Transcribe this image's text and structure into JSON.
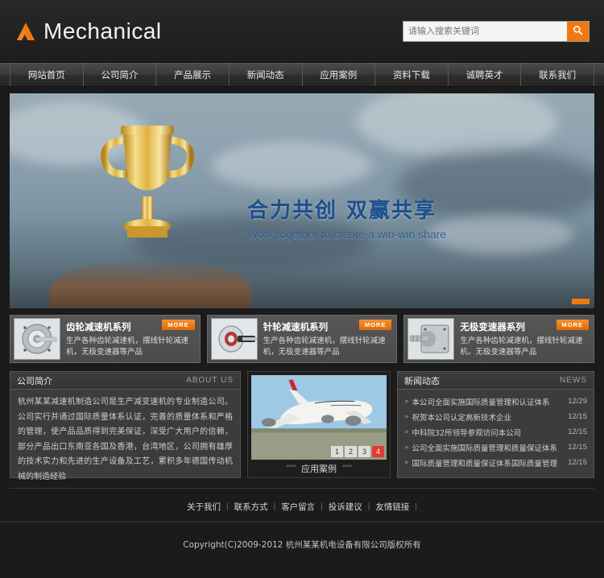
{
  "header": {
    "logo_text": "Mechanical",
    "logo_icon": "mountain-triangle-icon",
    "search": {
      "placeholder": "请输入搜索关键词",
      "value": "",
      "button_icon": "search-icon"
    },
    "accent_color": "#ef7911"
  },
  "nav": {
    "items": [
      {
        "label": "网站首页"
      },
      {
        "label": "公司简介"
      },
      {
        "label": "产品展示"
      },
      {
        "label": "新闻动态"
      },
      {
        "label": "应用案例"
      },
      {
        "label": "资料下载"
      },
      {
        "label": "诚聘英才"
      },
      {
        "label": "联系我们"
      }
    ]
  },
  "banner": {
    "title": "合力共创  双赢共享",
    "subtitle": "Work together to create a win-win share",
    "title_color": "#1c4f8c",
    "slides": [
      {
        "active": false
      },
      {
        "active": true
      }
    ]
  },
  "product_cards": [
    {
      "title": "齿轮减速机系列",
      "desc": "生产各种齿轮减速机，摆线针轮减速机，无极变速器等产品",
      "more_label": "MORE",
      "thumb_icon": "gear-reducer-icon"
    },
    {
      "title": "针轮减速机系列",
      "desc": "生产各种齿轮减速机，摆线针轮减速机，无极变速器等产品",
      "more_label": "MORE",
      "thumb_icon": "cycloid-reducer-icon"
    },
    {
      "title": "无极变速器系列",
      "desc": "生产各种齿轮减速机，摆线针轮减速机，无极变速器等产品",
      "more_label": "MORE",
      "thumb_icon": "variable-speed-drive-icon"
    }
  ],
  "about": {
    "title_cn": "公司简介",
    "title_en": "ABOUT US",
    "body": "杭州某某减速机制造公司是生产减变速机的专业制造公司。公司实行并通过国际质量体系认证，完善的质量体系和严格的管理，使产品品质得到完美保证，深受广大用户的信赖，部分产品出口东南亚各国及香港，台湾地区，公司拥有雄厚的技术实力和先进的生产设备及工艺，累积多年德国传动机械的制造经验"
  },
  "case_panel": {
    "caption": "应用案例",
    "caption_deco_left": "''''''''",
    "caption_deco_right": "''''''''",
    "image_icon": "airplane-photo",
    "pages": [
      {
        "label": "1",
        "active": false
      },
      {
        "label": "2",
        "active": false
      },
      {
        "label": "3",
        "active": false
      },
      {
        "label": "4",
        "active": true
      }
    ]
  },
  "news": {
    "title_cn": "新闻动态",
    "title_en": "NEWS",
    "items": [
      {
        "title": "本公司全面实施国际质量管理和认证体系",
        "date": "12/29"
      },
      {
        "title": "祝贺本公司认定高新技术企业",
        "date": "12/15"
      },
      {
        "title": "中科院32所领导参观访问本公司",
        "date": "12/15"
      },
      {
        "title": "公司全面实施国际质量管理和质量保证体系",
        "date": "12/15"
      },
      {
        "title": "国际质量管理和质量保证体系国际质量管理",
        "date": "12/15"
      }
    ]
  },
  "footer": {
    "links": [
      {
        "label": "关于我们"
      },
      {
        "label": "联系方式"
      },
      {
        "label": "客户留言"
      },
      {
        "label": "投诉建议"
      },
      {
        "label": "友情链接"
      }
    ],
    "separator": "|",
    "copyright": "Copyright(C)2009-2012 杭州某某机电设备有限公司版权所有"
  }
}
